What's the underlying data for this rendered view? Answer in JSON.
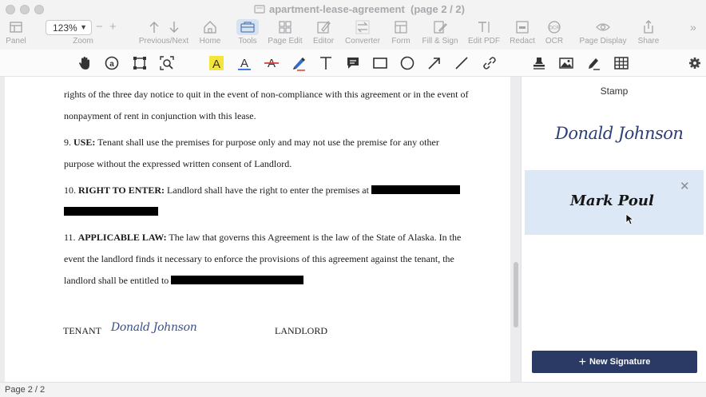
{
  "window": {
    "title": "apartment-lease-agreement",
    "page_indicator": "(page 2 / 2)"
  },
  "toolbar": {
    "zoom_value": "123%",
    "items": [
      {
        "label": "Panel",
        "icon": "panel-icon"
      },
      {
        "label": "Zoom",
        "icon": "zoom-icon"
      },
      {
        "label": "Previous/Next",
        "icon": "arrows-icon"
      },
      {
        "label": "Home",
        "icon": "home-icon"
      },
      {
        "label": "Tools",
        "icon": "tools-icon"
      },
      {
        "label": "Page Edit",
        "icon": "page-edit-icon"
      },
      {
        "label": "Editor",
        "icon": "editor-icon"
      },
      {
        "label": "Converter",
        "icon": "converter-icon"
      },
      {
        "label": "Form",
        "icon": "form-icon"
      },
      {
        "label": "Fill & Sign",
        "icon": "fill-sign-icon"
      },
      {
        "label": "Edit PDF",
        "icon": "edit-pdf-icon"
      },
      {
        "label": "Redact",
        "icon": "redact-icon"
      },
      {
        "label": "OCR",
        "icon": "ocr-icon"
      },
      {
        "label": "Page Display",
        "icon": "page-display-icon"
      },
      {
        "label": "Share",
        "icon": "share-icon"
      }
    ],
    "accent_color": "#2b3a64"
  },
  "document": {
    "para_intro_1": "rights of the three day notice to quit in the event of non-compliance with this agreement or in the event of",
    "para_intro_2": "nonpayment of rent in conjunction with this lease.",
    "use_num": "9.",
    "use_heading": "USE:",
    "use_line1": " Tenant shall use the premises for purpose only and may not use the premise for any other",
    "use_line2": "purpose without the expressed written   consent of Landlord.",
    "enter_num": "10.",
    "enter_heading": "RIGHT TO ENTER:",
    "enter_line1": " Landlord shall have the right to enter the premises at ",
    "law_num": "11.",
    "law_heading": "APPLICABLE LAW:",
    "law_line1": " The law that governs this Agreement is the law of the State of Alaska. In the",
    "law_line2": "event the landlord finds it necessary to enforce the provisions of this agreement against the tenant, the",
    "law_line3": "landlord shall be entitled to ",
    "tenant_label": "TENANT",
    "tenant_signature": "Donald Johnson",
    "landlord_label": "LANDLORD"
  },
  "panel": {
    "title": "Stamp",
    "signatures": [
      "Donald Johnson",
      "Mark Poul"
    ],
    "close_glyph": "✕",
    "new_signature_label": "New Signature"
  },
  "statusbar": {
    "page_text": "Page 2 / 2"
  }
}
